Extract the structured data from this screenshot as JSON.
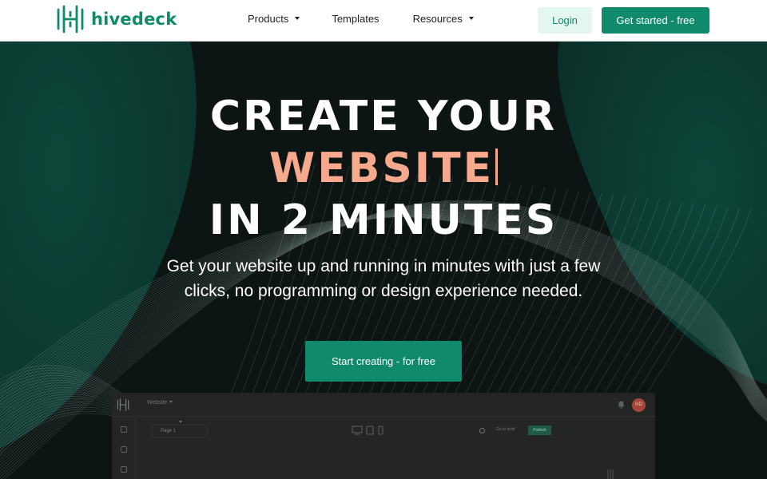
{
  "brand": {
    "name": "hivedeck",
    "color": "#0f8a6b"
  },
  "nav": {
    "items": [
      {
        "label": "Products",
        "has_dropdown": true
      },
      {
        "label": "Templates",
        "has_dropdown": false
      },
      {
        "label": "Resources",
        "has_dropdown": true
      }
    ],
    "login_label": "Login",
    "get_started_label": "Get started - free"
  },
  "hero": {
    "headline_line1": "CREATE YOUR",
    "headline_accent": "WEBSITE",
    "headline_line3": "IN 2 MINUTES",
    "subtitle": "Get your website up and running in minutes with just a few clicks, no programming or design experience needed.",
    "cta_label": "Start creating - for free",
    "accent_color": "#f7a98d"
  },
  "preview": {
    "site_selector": "Website",
    "page_selector": "Page 1",
    "avatar_initials": "HD",
    "live_label": "Go to draft",
    "publish_label": "Publish"
  },
  "colors": {
    "primary": "#0f8a6b",
    "primary_light": "#e4f6f0",
    "hero_bg": "#0c1514",
    "accent": "#f7a98d"
  },
  "icons": [
    "hivedeck-logo-icon",
    "chevron-down-icon",
    "bell-icon",
    "desktop-icon",
    "tablet-icon",
    "mobile-icon",
    "globe-icon",
    "grip-icon"
  ]
}
